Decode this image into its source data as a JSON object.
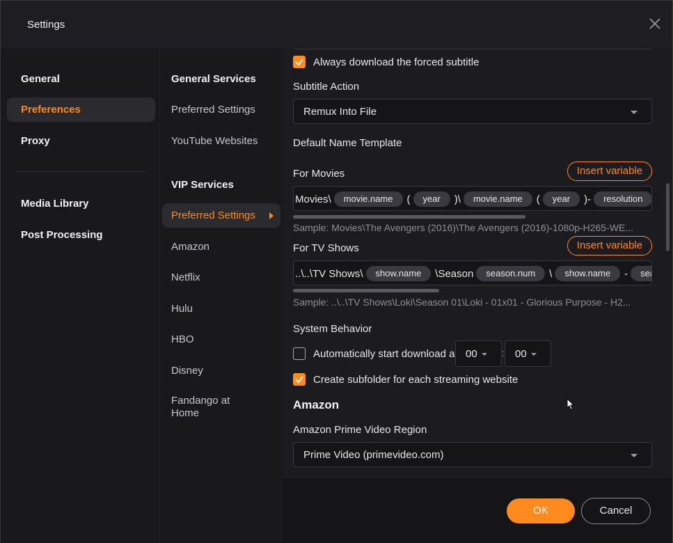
{
  "window": {
    "title": "Settings"
  },
  "sidebar": {
    "items": [
      {
        "label": "General"
      },
      {
        "label": "Preferences"
      },
      {
        "label": "Proxy"
      },
      {
        "label": "Media Library"
      },
      {
        "label": "Post Processing"
      }
    ],
    "active_index": 1
  },
  "subnav": {
    "general_heading": "General Services",
    "general_items": [
      "Preferred Settings",
      "YouTube Websites"
    ],
    "vip_heading": "VIP Services",
    "vip_items": [
      "Preferred Settings",
      "Amazon",
      "Netflix",
      "Hulu",
      "HBO",
      "Disney"
    ],
    "fandango_line1": "Fandango at",
    "fandango_line2": "Home"
  },
  "main": {
    "forced_subtitle": {
      "label": "Always download the forced subtitle",
      "checked": true
    },
    "subtitle_action": {
      "label": "Subtitle Action",
      "value": "Remux Into File"
    },
    "default_name_template": "Default Name Template",
    "movies": {
      "label": "For Movies",
      "insert_label": "Insert variable",
      "tokens": [
        {
          "text": "Movies\\"
        },
        {
          "chip": "movie.name"
        },
        {
          "text": "("
        },
        {
          "chip": "year"
        },
        {
          "text": ")\\"
        },
        {
          "chip": "movie.name"
        },
        {
          "text": "("
        },
        {
          "chip": "year"
        },
        {
          "text": ")-"
        },
        {
          "chip": "resolution"
        },
        {
          "text": "-"
        }
      ],
      "sample": "Sample: Movies\\The Avengers (2016)\\The Avengers (2016)-1080p-H265-WE..."
    },
    "tv": {
      "label": "For TV Shows",
      "insert_label": "Insert variable",
      "tokens": [
        {
          "text": "..\\..\\TV Shows\\"
        },
        {
          "chip": "show.name"
        },
        {
          "text": "\\Season"
        },
        {
          "chip": "season.num"
        },
        {
          "text": "\\"
        },
        {
          "chip": "show.name"
        },
        {
          "text": "-"
        },
        {
          "chip": "sea"
        }
      ],
      "sample": "Sample: ..\\..\\TV Shows\\Loki\\Season 01\\Loki - 01x01 - Glorious Purpose - H2..."
    },
    "system_behavior": {
      "heading": "System Behavior",
      "auto_start": {
        "label": "Automatically start download a",
        "checked": false
      },
      "hour": "00",
      "colon": ":",
      "minute": "00",
      "subfolder": {
        "label": "Create subfolder for each streaming website",
        "checked": true
      }
    },
    "amazon": {
      "heading": "Amazon",
      "region_label": "Amazon Prime Video Region",
      "region_value": "Prime Video (primevideo.com)"
    }
  },
  "footer": {
    "ok_label": "OK",
    "cancel_label": "Cancel"
  },
  "colors": {
    "accent": "#ff8a1d",
    "background": "#151518",
    "panel": "#1c1c20"
  }
}
